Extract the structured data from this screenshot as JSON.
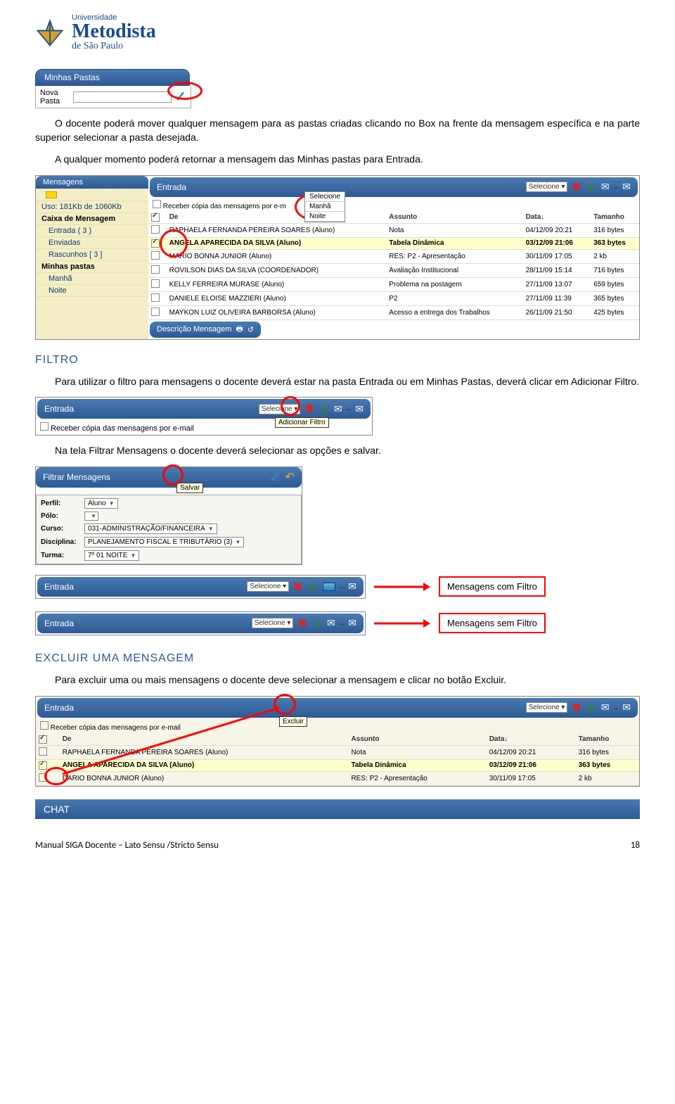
{
  "logo": {
    "uni": "Universidade",
    "met": "Metodista",
    "sp": "de São Paulo"
  },
  "minhasPastasTitle": "Minhas Pastas",
  "novaPastaLabel": "Nova Pasta",
  "para1": "O docente poderá mover qualquer mensagem para as pastas criadas clicando no Box na frente da mensagem específica e na parte superior selecionar a pasta desejada.",
  "para2": "A qualquer momento poderá retornar a mensagem das Minhas pastas para Entrada.",
  "shot1": {
    "sideHead": "Mensagens",
    "uso": "Uso: 181Kb de 1060Kb",
    "caixa": "Caixa de Mensagem",
    "entrada": "Entrada  ( 3 )",
    "enviadas": "Enviadas",
    "rascunhos": "Rascunhos  [ 3 ]",
    "minhasPastas": "Minhas pastas",
    "manha": "Manhã",
    "noite": "Noite",
    "toolbarTitle": "Entrada",
    "selecione": "Selecione",
    "drop": [
      "Selecione",
      "Manhã",
      "Noite"
    ],
    "receberCopia": "Receber cópia das mensagens por e-m",
    "headers": [
      "De",
      "Assunto",
      "Data↓",
      "Tamanho"
    ],
    "rows": [
      {
        "de": "RAPHAELA FERNANDA PEREIRA SOARES (Aluno)",
        "as": "Nota",
        "dt": "04/12/09 20:21",
        "tm": "316 bytes"
      },
      {
        "de": "ANGELA APARECIDA DA SILVA (Aluno)",
        "as": "Tabela Dinâmica",
        "dt": "03/12/09 21:06",
        "tm": "363 bytes"
      },
      {
        "de": "MARIO BONNA JUNIOR (Aluno)",
        "as": "RES: P2 - Apresentação",
        "dt": "30/11/09 17:05",
        "tm": "2 kb"
      },
      {
        "de": "ROVILSON DIAS DA SILVA (COORDENADOR)",
        "as": "Avaliação Institucional",
        "dt": "28/11/09 15:14",
        "tm": "716 bytes"
      },
      {
        "de": "KELLY FERREIRA MURASE (Aluno)",
        "as": "Problema na postagem",
        "dt": "27/11/09 13:07",
        "tm": "659 bytes"
      },
      {
        "de": "DANIELE ELOISE MAZZIERI (Aluno)",
        "as": "P2",
        "dt": "27/11/09 11:39",
        "tm": "365 bytes"
      },
      {
        "de": "MAYKON LUIZ OLIVEIRA BARBORSA (Aluno)",
        "as": "Acesso a entrega dos Trabalhos",
        "dt": "26/11/09 21:50",
        "tm": "425 bytes"
      }
    ],
    "descMsg": "Descrição Mensagem"
  },
  "filtroTitle": "FILTRO",
  "filtroPara": "Para utilizar o filtro para mensagens o docente deverá estar na pasta Entrada ou em Minhas Pastas, deverá clicar em Adicionar Filtro.",
  "shot2": {
    "title": "Entrada",
    "selecione": "Selecione",
    "receberCopia": "Receber cópia das mensagens por e-mail",
    "tooltip": "Adicionar Filtro"
  },
  "filtroPara2": "Na tela Filtrar Mensagens o docente deverá selecionar as opções e salvar.",
  "shot3": {
    "title": "Filtrar Mensagens",
    "salvarTip": "Salvar",
    "perfil": [
      "Perfil:",
      "Aluno"
    ],
    "polo": "Pólo:",
    "curso": [
      "Curso:",
      "031-ADMINISTRAÇÃO/FINANCEIRA"
    ],
    "disciplina": [
      "Disciplina:",
      "PLANEJAMENTO FISCAL E TRIBUTÁRIO (3)"
    ],
    "turma": [
      "Turma:",
      "7º 01 NOITE"
    ]
  },
  "callout1": "Mensagens com Filtro",
  "callout2": "Mensagens sem Filtro",
  "entradaBar": "Entrada",
  "selecioneBar": "Selecione",
  "excluirTitle": "EXCLUIR UMA MENSAGEM",
  "excluirPara": "Para excluir uma ou mais mensagens o docente deve selecionar a mensagem e clicar no botão Excluir.",
  "shot5": {
    "title": "Entrada",
    "selecione": "Selecione",
    "receberCopia": "Receber cópia das mensagens por e-mail",
    "tooltip": "Excluir",
    "headers": [
      "De",
      "Assunto",
      "Data↓",
      "Tamanho"
    ],
    "rows": [
      {
        "de": "RAPHAELA FERNANDA PEREIRA SOARES (Aluno)",
        "as": "Nota",
        "dt": "04/12/09 20:21",
        "tm": "316 bytes"
      },
      {
        "de": "ANGELA APARECIDA DA SILVA (Aluno)",
        "as": "Tabela Dinâmica",
        "dt": "03/12/09 21:06",
        "tm": "363 bytes"
      },
      {
        "de": "DARIO BONNA JUNIOR (Aluno)",
        "as": "RES: P2 - Apresentação",
        "dt": "30/11/09 17:05",
        "tm": "2 kb"
      }
    ]
  },
  "chatTitle": "CHAT",
  "footerLeft": "Manual SIGA Docente – Lato Sensu /Stricto Sensu",
  "footerRight": "18"
}
